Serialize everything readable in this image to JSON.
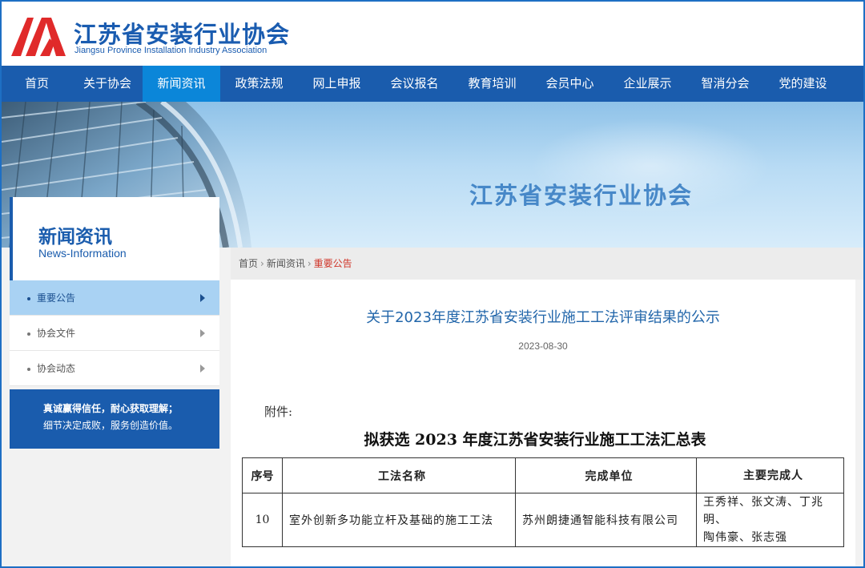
{
  "header": {
    "logo_cn": "江苏省安装行业协会",
    "logo_en": "Jiangsu Province Installation Industry Association"
  },
  "nav": {
    "items": [
      "首页",
      "关于协会",
      "新闻资讯",
      "政策法规",
      "网上申报",
      "会议报名",
      "教育培训",
      "会员中心",
      "企业展示",
      "智消分会",
      "党的建设"
    ],
    "active_index": 2
  },
  "banner": {
    "title": "江苏省安装行业协会"
  },
  "sidebar": {
    "title_cn": "新闻资讯",
    "title_en": "News-Information",
    "items": [
      {
        "label": "重要公告",
        "active": true
      },
      {
        "label": "协会文件",
        "active": false
      },
      {
        "label": "协会动态",
        "active": false
      }
    ],
    "slogan_line1": "真诚赢得信任，耐心获取理解；",
    "slogan_line2": "细节决定成败，服务创造价值。"
  },
  "breadcrumb": {
    "items": [
      "首页",
      "新闻资讯"
    ],
    "current": "重要公告",
    "separator": "›"
  },
  "article": {
    "title": "关于2023年度江苏省安装行业施工工法评审结果的公示",
    "date": "2023-08-30",
    "attachment_label": "附件:",
    "table_title": "拟获选 2023 年度江苏省安装行业施工工法汇总表",
    "table": {
      "headers": [
        "序号",
        "工法名称",
        "完成单位",
        "主要完成人"
      ],
      "rows": [
        {
          "no": "10",
          "name": "室外创新多功能立杆及基础的施工工法",
          "unit": "苏州朗捷通智能科技有限公司",
          "people_line1": "王秀祥、张文涛、丁兆明、",
          "people_line2": "陶伟豪、张志强"
        }
      ]
    }
  },
  "colors": {
    "brand_blue": "#1a5cad",
    "nav_active": "#0b86d9",
    "breadcrumb_current": "#d0362a",
    "title_blue": "#2266aa",
    "logo_red": "#e02a2a"
  }
}
